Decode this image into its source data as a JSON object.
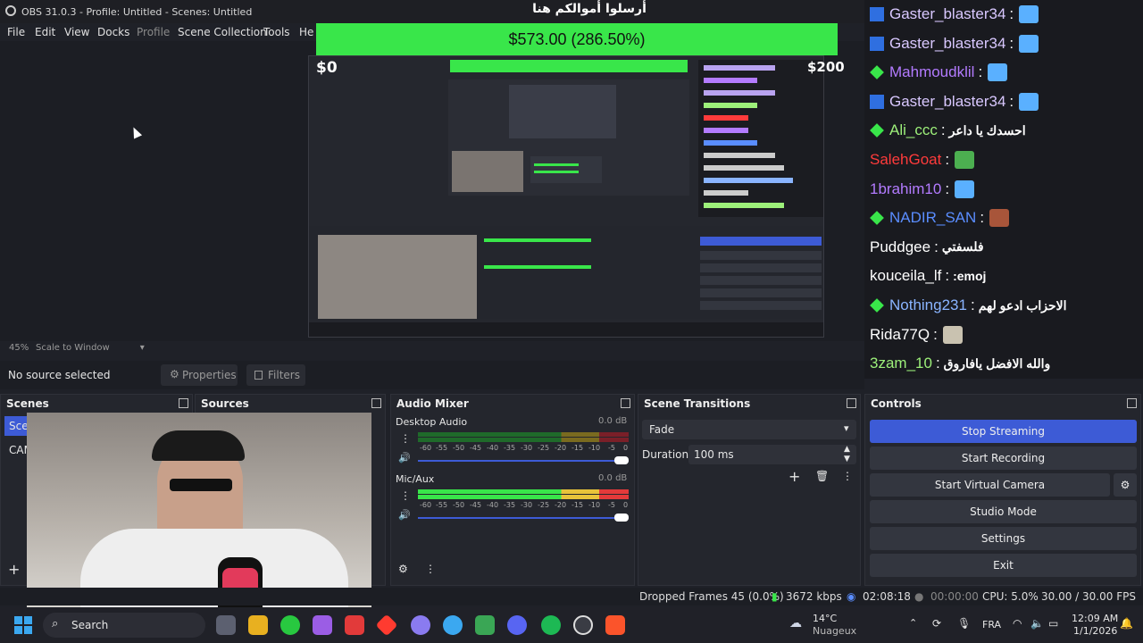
{
  "window": {
    "title": "OBS 31.0.3 - Profile: Untitled - Scenes: Untitled"
  },
  "menu": {
    "file": "File",
    "edit": "Edit",
    "view": "View",
    "docks": "Docks",
    "profile": "Profile",
    "scene_collection": "Scene Collection",
    "tools": "Tools",
    "help": "Help"
  },
  "donation": {
    "title": "أرسلوا أموالكم هنا",
    "amount": "$573.00 (286.50%)",
    "min": "$0",
    "max": "$200",
    "progress_fraction": 1.0,
    "bar_color": "#39e64a"
  },
  "chat": [
    {
      "user": "Gaster_blaster34",
      "color": "#d9c8ff",
      "badge": "sub-badge",
      "message": "",
      "emote": "wings-emote"
    },
    {
      "user": "Gaster_blaster34",
      "color": "#d9c8ff",
      "badge": "sub-badge",
      "message": "",
      "emote": "wings-emote"
    },
    {
      "user": "Mahmoudklil",
      "color": "#b37bff",
      "badge": "diamond-badge",
      "message": "",
      "emote": "wings-emote"
    },
    {
      "user": "Gaster_blaster34",
      "color": "#d9c8ff",
      "badge": "sub-badge",
      "message": "",
      "emote": "wings-emote"
    },
    {
      "user": "Ali_ccc",
      "color": "#9df07a",
      "badge": "diamond-badge",
      "message": "احسدك يا داعر",
      "emote": ""
    },
    {
      "user": "SalehGoat",
      "color": "#ff3b3b",
      "badge": "",
      "message": "",
      "emote": "frog-emote"
    },
    {
      "user": "1brahim10",
      "color": "#b37bff",
      "badge": "",
      "message": "",
      "emote": "wings-emote"
    },
    {
      "user": "NADIR_SAN",
      "color": "#5a8dff",
      "badge": "diamond-badge",
      "message": "",
      "emote": "face-emote"
    },
    {
      "user": "Puddgee",
      "color": "#ffffff",
      "badge": "",
      "message": "فلسفتي",
      "emote": ""
    },
    {
      "user": "kouceila_lf",
      "color": "#ffffff",
      "badge": "",
      "message": ":emoj",
      "emote": ""
    },
    {
      "user": "Nothing231",
      "color": "#8ab4ff",
      "badge": "diamond-badge",
      "message": "الاحزاب ادعو لهم",
      "emote": ""
    },
    {
      "user": "Rida77Q",
      "color": "#ffffff",
      "badge": "",
      "message": "",
      "emote": "building-emote"
    },
    {
      "user": "3zam_10",
      "color": "#9df07a",
      "badge": "",
      "message": "والله الافضل يافاروق",
      "emote": ""
    }
  ],
  "preview": {
    "zoom": "45%",
    "scale": "Scale to Window"
  },
  "source_bar": {
    "status": "No source selected",
    "properties": "Properties",
    "filters": "Filters"
  },
  "scenes": {
    "title": "Scenes",
    "items": [
      "Scene",
      "CAM"
    ]
  },
  "sources": {
    "title": "Sources"
  },
  "mixer": {
    "title": "Audio Mixer",
    "channels": [
      {
        "name": "Desktop Audio",
        "db": "0.0 dB",
        "level": 0.0
      },
      {
        "name": "Mic/Aux",
        "db": "0.0 dB",
        "level": 0.95
      }
    ],
    "scale": [
      "-60",
      "-55",
      "-50",
      "-45",
      "-40",
      "-35",
      "-30",
      "-25",
      "-20",
      "-15",
      "-10",
      "-5",
      "0"
    ]
  },
  "transitions": {
    "title": "Scene Transitions",
    "selected": "Fade",
    "duration_label": "Duration",
    "duration_value": "100 ms"
  },
  "controls": {
    "title": "Controls",
    "stop_streaming": "Stop Streaming",
    "start_recording": "Start Recording",
    "start_virtual_camera": "Start Virtual Camera",
    "studio_mode": "Studio Mode",
    "settings": "Settings",
    "exit": "Exit"
  },
  "status": {
    "dropped_frames": "Dropped Frames 45 (0.0%)",
    "bitrate": "3672 kbps",
    "stream_time": "02:08:18",
    "rec_time": "00:00:00",
    "cpu": "CPU: 5.0%",
    "fps": "30.00 / 30.00 FPS"
  },
  "taskbar": {
    "search": "Search",
    "weather_temp": "14°C",
    "weather_desc": "Nuageux",
    "lang": "FRA",
    "time": "12:09 AM",
    "date": "1/1/2026"
  }
}
